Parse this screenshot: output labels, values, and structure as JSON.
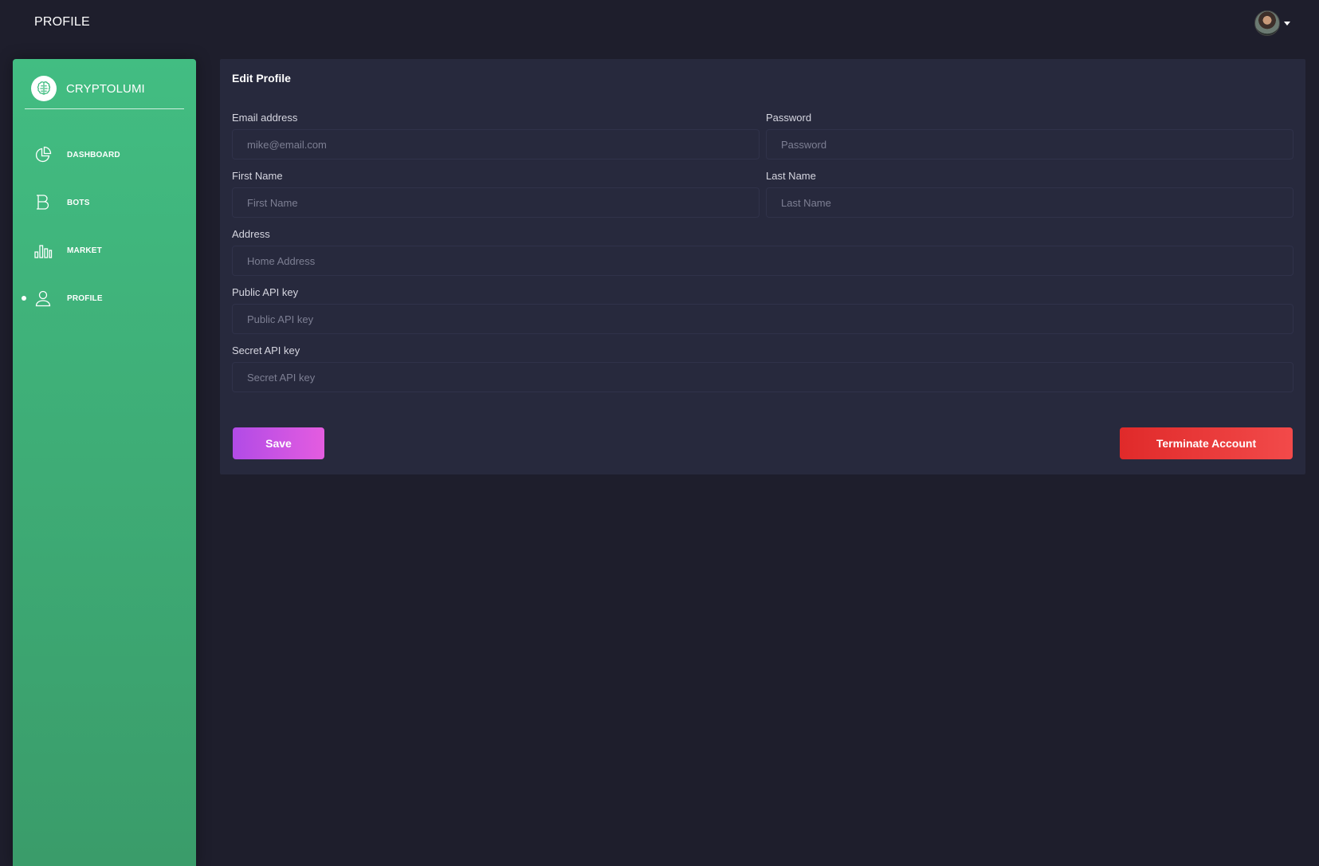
{
  "header": {
    "title": "PROFILE"
  },
  "sidebar": {
    "brand": "CRYPTOLUMI",
    "items": [
      {
        "label": "DASHBOARD",
        "icon": "pie-chart-icon"
      },
      {
        "label": "BOTS",
        "icon": "bitcoin-b-icon"
      },
      {
        "label": "MARKET",
        "icon": "bar-chart-icon"
      },
      {
        "label": "PROFILE",
        "icon": "user-icon",
        "active": true
      }
    ]
  },
  "form": {
    "title": "Edit Profile",
    "email": {
      "label": "Email address",
      "placeholder": "mike@email.com",
      "value": ""
    },
    "password": {
      "label": "Password",
      "placeholder": "Password",
      "value": ""
    },
    "first_name": {
      "label": "First Name",
      "placeholder": "First Name",
      "value": ""
    },
    "last_name": {
      "label": "Last Name",
      "placeholder": "Last Name",
      "value": ""
    },
    "address": {
      "label": "Address",
      "placeholder": "Home Address",
      "value": ""
    },
    "public_api_key": {
      "label": "Public API key",
      "placeholder": "Public API key",
      "value": ""
    },
    "secret_api_key": {
      "label": "Secret API key",
      "placeholder": "Secret API key",
      "value": ""
    },
    "save_label": "Save",
    "terminate_label": "Terminate Account"
  },
  "colors": {
    "background": "#1e1e2c",
    "card": "#27293d",
    "sidebar_top": "#42bd82",
    "sidebar_bottom": "#3a9c6a",
    "save_button": "#c452e3",
    "terminate_button": "#ea3a3a"
  }
}
